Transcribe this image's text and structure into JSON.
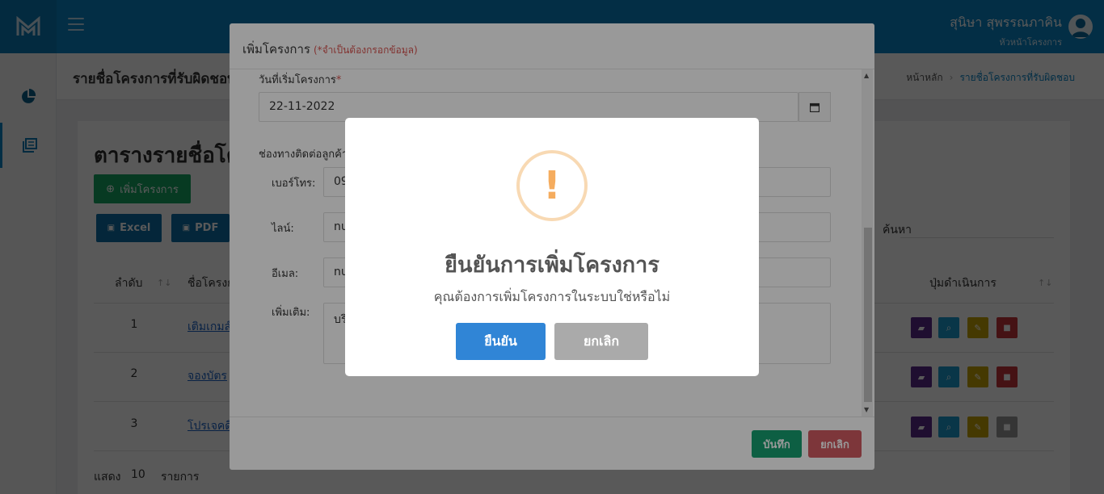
{
  "topbar": {
    "user_name": "สุนิษา สุพรรณภาคิน",
    "user_role": "หัวหน้าโครงการ"
  },
  "header": {
    "page_title": "รายชื่อโครงการที่รับผิดชอบ",
    "breadcrumb_home": "หน้าหลัก",
    "breadcrumb_current": "รายชื่อโครงการที่รับผิดชอบ"
  },
  "main": {
    "card_title": "ตารางรายชื่อโครงการ",
    "add_button": "เพิ่มโครงการ",
    "export_excel": "Excel",
    "export_pdf": "PDF",
    "search_label": "ค้นหา",
    "columns": {
      "index": "ลำดับ",
      "name": "ชื่อโครงการ",
      "actions": "ปุ่มดำเนินการ"
    },
    "rows": [
      {
        "index": "1",
        "name": "เติมเกมส์"
      },
      {
        "index": "2",
        "name": "จองบัตร"
      },
      {
        "index": "3",
        "name": "โปรเจคดี"
      }
    ],
    "show_label": "แสดง",
    "show_count": "10",
    "show_suffix": "รายการ"
  },
  "modal": {
    "title": "เพิ่มโครงการ",
    "required_note": "(*จำเป็นต้องกรอกข้อมูล)",
    "start_date_label": "วันที่เริ่มโครงการ",
    "start_date_value": "22-11-2022",
    "contact_label": "ช่องทางติดต่อลูกค้า",
    "phone_label": "เบอร์โทร:",
    "phone_value": "09",
    "line_label": "ไลน์:",
    "line_value": "nu",
    "email_label": "อีเมล:",
    "email_value": "nu",
    "more_label": "เพิ่มเติม:",
    "more_value": "บริ",
    "save_button": "บันทึก",
    "cancel_button": "ยกเลิก"
  },
  "confirm": {
    "title": "ยืนยันการเพิ่มโครงการ",
    "text": "คุณต้องการเพิ่มโครงการในระบบใช่หรือไม่",
    "confirm_button": "ยืนยัน",
    "cancel_button": "ยกเลิก"
  },
  "colors": {
    "topbar": "#0a86c9",
    "confirm_button": "#3085d6",
    "warning": "#f5ac5e",
    "save": "#179f70",
    "cancel": "#d05a62"
  }
}
